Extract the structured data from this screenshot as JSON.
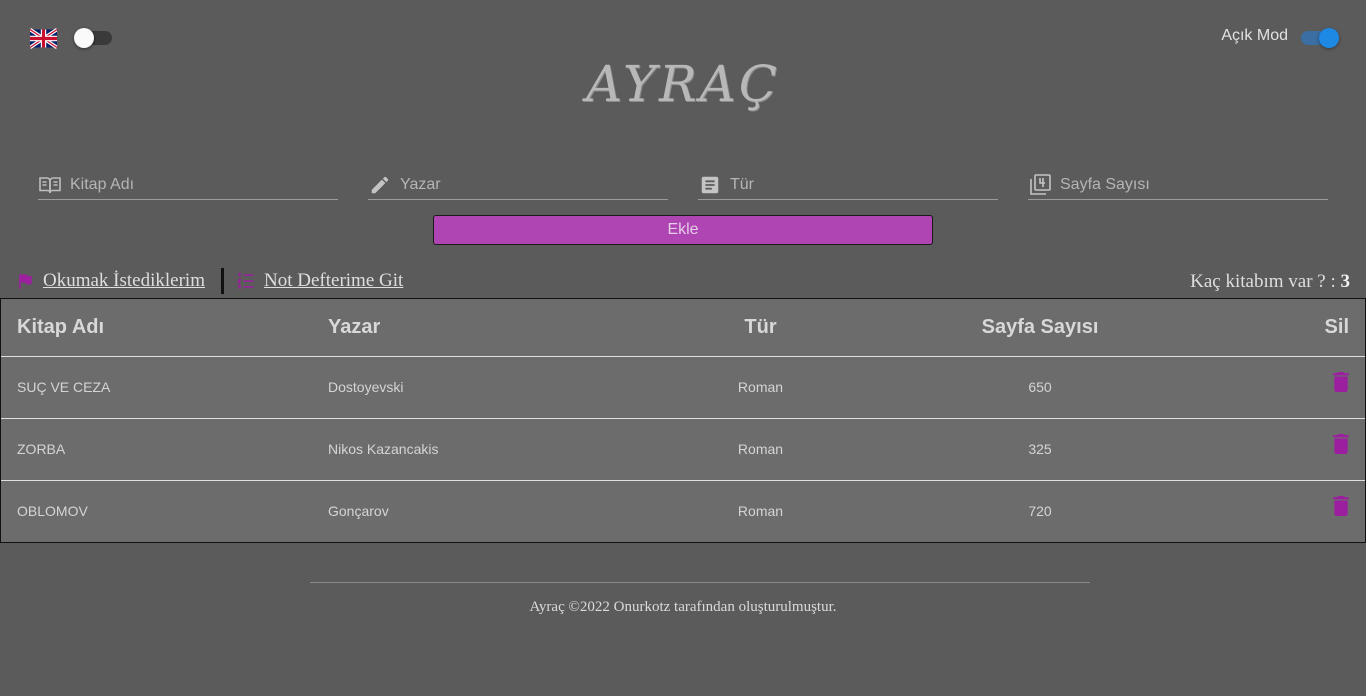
{
  "header": {
    "language_flag": "uk-flag-icon",
    "mode_label": "Açık Mod",
    "logo": "AYRAÇ"
  },
  "form": {
    "book_name_placeholder": "Kitap Adı",
    "author_placeholder": "Yazar",
    "genre_placeholder": "Tür",
    "pages_placeholder": "Sayfa Sayısı",
    "add_label": "Ekle"
  },
  "nav": {
    "wishlist_label": "Okumak İstediklerim",
    "notebook_label": "Not Defterime Git",
    "count_label": "Kaç kitabım var ? : ",
    "count_value": "3"
  },
  "table": {
    "headers": [
      "Kitap Adı",
      "Yazar",
      "Tür",
      "Sayfa Sayısı",
      "Sil"
    ],
    "rows": [
      {
        "title": "SUÇ VE CEZA",
        "author": "Dostoyevski",
        "genre": "Roman",
        "pages": "650"
      },
      {
        "title": "ZORBA",
        "author": "Nikos Kazancakis",
        "genre": "Roman",
        "pages": "325"
      },
      {
        "title": "OBLOMOV",
        "author": "Gonçarov",
        "genre": "Roman",
        "pages": "720"
      }
    ]
  },
  "footer": {
    "text": "Ayraç ©2022 Onurkotz tarafından oluşturulmuştur."
  },
  "colors": {
    "background": "#5b5b5b",
    "accent": "#ae45b2",
    "trash": "#9c1fa0",
    "toggle_on": "#1e88e5"
  }
}
